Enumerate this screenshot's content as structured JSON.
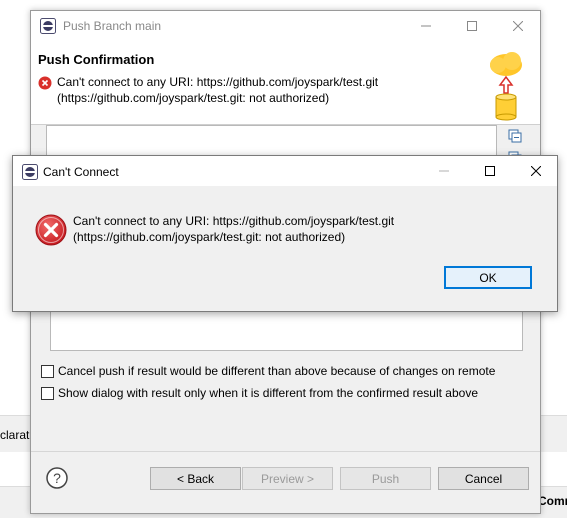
{
  "background": {
    "declaration_fragment": "claratio",
    "comment_fragment": "Comm"
  },
  "push_dialog": {
    "title": "Push Branch main",
    "header_title": "Push Confirmation",
    "header_message_line1": "Can't connect to any URI: https://github.com/joyspark/test.git",
    "header_message_line2": "(https://github.com/joyspark/test.git: not authorized)",
    "option_cancel_push": "Cancel push if result would be different than above because of changes on remote",
    "option_show_dialog": "Show dialog with result only when it is different from the confirmed result above",
    "buttons": {
      "back": "< Back",
      "preview": "Preview >",
      "push": "Push",
      "cancel": "Cancel"
    }
  },
  "cant_connect_dialog": {
    "title": "Can't Connect",
    "message_line1": "Can't connect to any URI: https://github.com/joyspark/test.git",
    "message_line2": "(https://github.com/joyspark/test.git: not authorized)",
    "ok_label": "OK"
  },
  "icons": {
    "app": "eclipse-icon",
    "error": "error-icon",
    "help": "help-icon",
    "wizard": "push-wizard-icon"
  },
  "colors": {
    "error_red": "#d9302b",
    "focus_blue": "#0078d7",
    "dialog_bg": "#f0f0f0"
  }
}
